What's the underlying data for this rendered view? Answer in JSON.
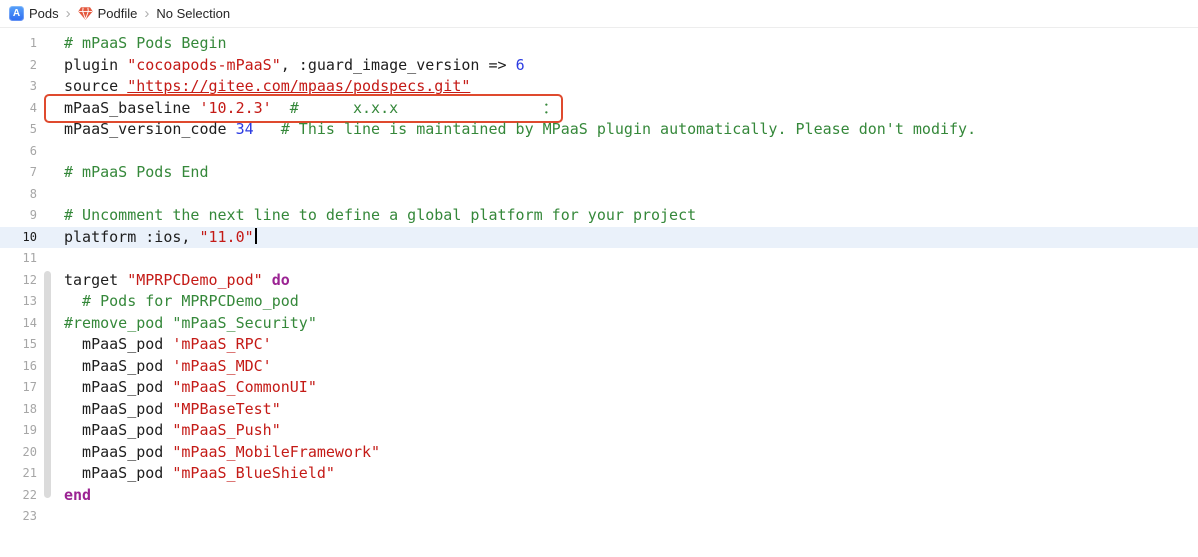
{
  "breadcrumb": {
    "project": "Pods",
    "project_icon_letter": "A",
    "file": "Podfile",
    "selection": "No Selection",
    "separator": "›"
  },
  "editor": {
    "active_line": 10,
    "total_lines": 23,
    "colors": {
      "plain": "#1e1e1e",
      "comment": "#35883a",
      "string": "#c41a16",
      "url": "#c41a16",
      "number": "#2b3be2",
      "keyword": "#9b2393",
      "annotation_box": "#df4a2e",
      "active_line_bg": "#eaf1fa",
      "line_number": "#a6a6a6",
      "fold_ribbon": "#dbdbdb"
    },
    "fold_ribbon": {
      "from_line": 12,
      "to_line": 22
    },
    "lines": [
      {
        "n": 1,
        "tokens": [
          {
            "t": "# mPaaS Pods Begin",
            "c": "comment"
          }
        ]
      },
      {
        "n": 2,
        "tokens": [
          {
            "t": "plugin ",
            "c": "plain"
          },
          {
            "t": "\"cocoapods-mPaaS\"",
            "c": "string"
          },
          {
            "t": ", :guard_image_version => ",
            "c": "plain"
          },
          {
            "t": "6",
            "c": "number"
          }
        ]
      },
      {
        "n": 3,
        "tokens": [
          {
            "t": "source ",
            "c": "plain"
          },
          {
            "t": "\"https://gitee.com/mpaas/podspecs.git\"",
            "c": "url"
          }
        ]
      },
      {
        "n": 4,
        "tokens": [
          {
            "t": "mPaaS_baseline ",
            "c": "plain"
          },
          {
            "t": "'10.2.3'",
            "c": "string"
          },
          {
            "t": "  ",
            "c": "plain"
          },
          {
            "t": "#      x.x.x                ：",
            "c": "comment"
          }
        ],
        "annotation_box": true
      },
      {
        "n": 5,
        "tokens": [
          {
            "t": "mPaaS_version_code ",
            "c": "plain"
          },
          {
            "t": "34",
            "c": "number"
          },
          {
            "t": "   ",
            "c": "plain"
          },
          {
            "t": "# This line is maintained by MPaaS plugin automatically. Please don't modify.",
            "c": "comment"
          }
        ]
      },
      {
        "n": 6,
        "tokens": []
      },
      {
        "n": 7,
        "tokens": [
          {
            "t": "# mPaaS Pods End",
            "c": "comment"
          }
        ]
      },
      {
        "n": 8,
        "tokens": []
      },
      {
        "n": 9,
        "tokens": [
          {
            "t": "# Uncomment the next line to define a global platform for your project",
            "c": "comment"
          }
        ]
      },
      {
        "n": 10,
        "tokens": [
          {
            "t": "platform :ios, ",
            "c": "plain"
          },
          {
            "t": "\"11.0\"",
            "c": "string"
          }
        ],
        "active": true,
        "cursor": true
      },
      {
        "n": 11,
        "tokens": []
      },
      {
        "n": 12,
        "tokens": [
          {
            "t": "target ",
            "c": "plain"
          },
          {
            "t": "\"MPRPCDemo_pod\"",
            "c": "string"
          },
          {
            "t": " ",
            "c": "plain"
          },
          {
            "t": "do",
            "c": "keyword"
          }
        ]
      },
      {
        "n": 13,
        "tokens": [
          {
            "t": "  # Pods for MPRPCDemo_pod",
            "c": "comment"
          }
        ]
      },
      {
        "n": 14,
        "tokens": [
          {
            "t": "#remove_pod \"mPaaS_Security\"",
            "c": "comment"
          }
        ]
      },
      {
        "n": 15,
        "tokens": [
          {
            "t": "  mPaaS_pod ",
            "c": "plain"
          },
          {
            "t": "'mPaaS_RPC'",
            "c": "string"
          }
        ]
      },
      {
        "n": 16,
        "tokens": [
          {
            "t": "  mPaaS_pod ",
            "c": "plain"
          },
          {
            "t": "'mPaaS_MDC'",
            "c": "string"
          }
        ]
      },
      {
        "n": 17,
        "tokens": [
          {
            "t": "  mPaaS_pod ",
            "c": "plain"
          },
          {
            "t": "\"mPaaS_CommonUI\"",
            "c": "string"
          }
        ]
      },
      {
        "n": 18,
        "tokens": [
          {
            "t": "  mPaaS_pod ",
            "c": "plain"
          },
          {
            "t": "\"MPBaseTest\"",
            "c": "string"
          }
        ]
      },
      {
        "n": 19,
        "tokens": [
          {
            "t": "  mPaaS_pod ",
            "c": "plain"
          },
          {
            "t": "\"mPaaS_Push\"",
            "c": "string"
          }
        ]
      },
      {
        "n": 20,
        "tokens": [
          {
            "t": "  mPaaS_pod ",
            "c": "plain"
          },
          {
            "t": "\"mPaaS_MobileFramework\"",
            "c": "string"
          }
        ]
      },
      {
        "n": 21,
        "tokens": [
          {
            "t": "  mPaaS_pod ",
            "c": "plain"
          },
          {
            "t": "\"mPaaS_BlueShield\"",
            "c": "string"
          }
        ]
      },
      {
        "n": 22,
        "tokens": [
          {
            "t": "end",
            "c": "keyword"
          }
        ]
      },
      {
        "n": 23,
        "tokens": []
      }
    ]
  }
}
